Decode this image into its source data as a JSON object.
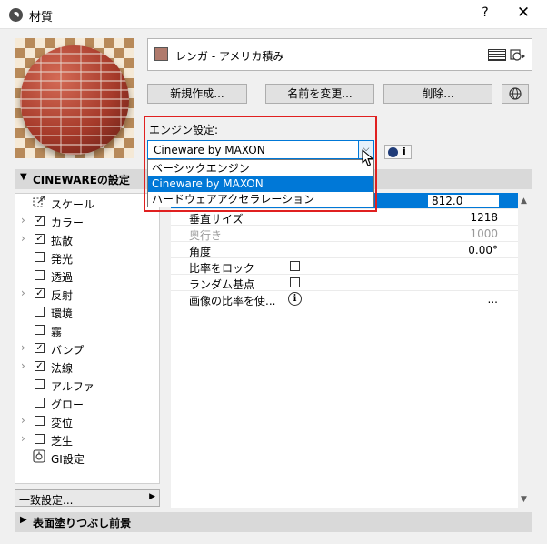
{
  "window": {
    "title": "材質",
    "help": "?",
    "close": "✕"
  },
  "material": {
    "name": "レンガ - アメリカ積み",
    "swatch_color": "#b07a6c"
  },
  "buttons": {
    "new": "新規作成...",
    "rename": "名前を変更...",
    "delete": "削除..."
  },
  "engine": {
    "label": "エンジン設定:",
    "selected": "Cineware by MAXON",
    "options": [
      "ベーシックエンジン",
      "Cineware by MAXON",
      "ハードウェアアクセラレーション"
    ],
    "info_glyph": "i"
  },
  "cineware_section": {
    "title": "CINEWAREの設定"
  },
  "channels": [
    {
      "label": "スケール",
      "expandable": false,
      "checkbox": false,
      "icon": true,
      "selected": true
    },
    {
      "label": "カラー",
      "expandable": true,
      "checked": true
    },
    {
      "label": "拡散",
      "expandable": true,
      "checked": true
    },
    {
      "label": "発光",
      "expandable": false,
      "checked": false
    },
    {
      "label": "透過",
      "expandable": false,
      "checked": false
    },
    {
      "label": "反射",
      "expandable": true,
      "checked": true
    },
    {
      "label": "環境",
      "expandable": false,
      "checked": false
    },
    {
      "label": "霧",
      "expandable": false,
      "checked": false
    },
    {
      "label": "バンプ",
      "expandable": true,
      "checked": true
    },
    {
      "label": "法線",
      "expandable": true,
      "checked": true
    },
    {
      "label": "アルファ",
      "expandable": false,
      "checked": false
    },
    {
      "label": "グロー",
      "expandable": false,
      "checked": false
    },
    {
      "label": "変位",
      "expandable": true,
      "checked": false
    },
    {
      "label": "芝生",
      "expandable": true,
      "checked": false
    },
    {
      "label": "GI設定",
      "expandable": false,
      "checkbox": false,
      "icon": true
    }
  ],
  "properties": {
    "width_value": "812.0",
    "rows": [
      {
        "label": "垂直サイズ",
        "value": "1218"
      },
      {
        "label": "奥行き",
        "value": "1000",
        "disabled": true
      },
      {
        "label": "角度",
        "value": "0.00°"
      },
      {
        "label": "比率をロック",
        "value": ""
      },
      {
        "label": "ランダム基点",
        "value": ""
      },
      {
        "label": "画像の比率を使...",
        "value": "..."
      }
    ],
    "info_glyph": "i"
  },
  "consistency_button": "一致設定...",
  "bottom_section": {
    "title": "表面塗りつぶし前景"
  },
  "icons": {
    "app": "archicad-icon",
    "hatch": "hatch-pattern-icon",
    "menu": "material-menu-icon",
    "globe": "globe-icon",
    "c4d": "cinema4d-icon",
    "scale": "scale-icon",
    "gi": "gi-settings-icon"
  }
}
